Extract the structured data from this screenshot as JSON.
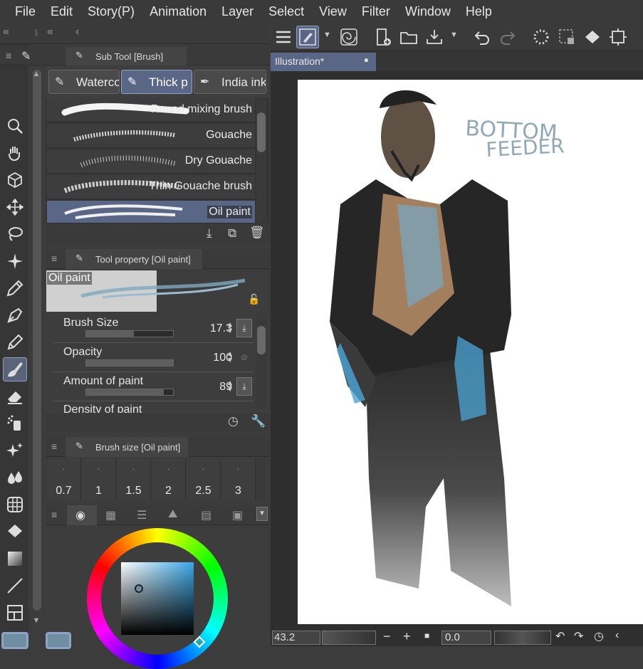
{
  "menu": [
    "File",
    "Edit",
    "Story(P)",
    "Animation",
    "Layer",
    "Select",
    "View",
    "Filter",
    "Window",
    "Help"
  ],
  "subtool": {
    "title": "Sub Tool [Brush]",
    "tabs": [
      "Waterco",
      "Thick p",
      "India ink"
    ],
    "brushes": [
      "Round mixing brush",
      "Gouache",
      "Dry Gouache",
      "Thin Gouache brush",
      "Oil paint"
    ]
  },
  "toolprop": {
    "title": "Tool property [Oil paint]",
    "preview_label": "Oil paint",
    "props": [
      {
        "name": "Brush Size",
        "value": "17.3",
        "level": 0.55
      },
      {
        "name": "Opacity",
        "value": "100",
        "level": 1.0
      },
      {
        "name": "Amount of paint",
        "value": "89",
        "level": 0.89
      },
      {
        "name": "Density of paint",
        "value": ""
      }
    ]
  },
  "brushsize": {
    "title": "Brush size [Oil paint]",
    "sizes": [
      "0.7",
      "1",
      "1.5",
      "2",
      "2.5",
      "3"
    ]
  },
  "document": {
    "tab": "Illustration*",
    "sketch_text_1": "BOTTOM",
    "sketch_text_2": "FEEDER"
  },
  "status": {
    "zoom": "43.2",
    "angle": "0.0"
  },
  "colors": {
    "accent": "#5a6686",
    "hue_marker": "#2f5f7a"
  }
}
